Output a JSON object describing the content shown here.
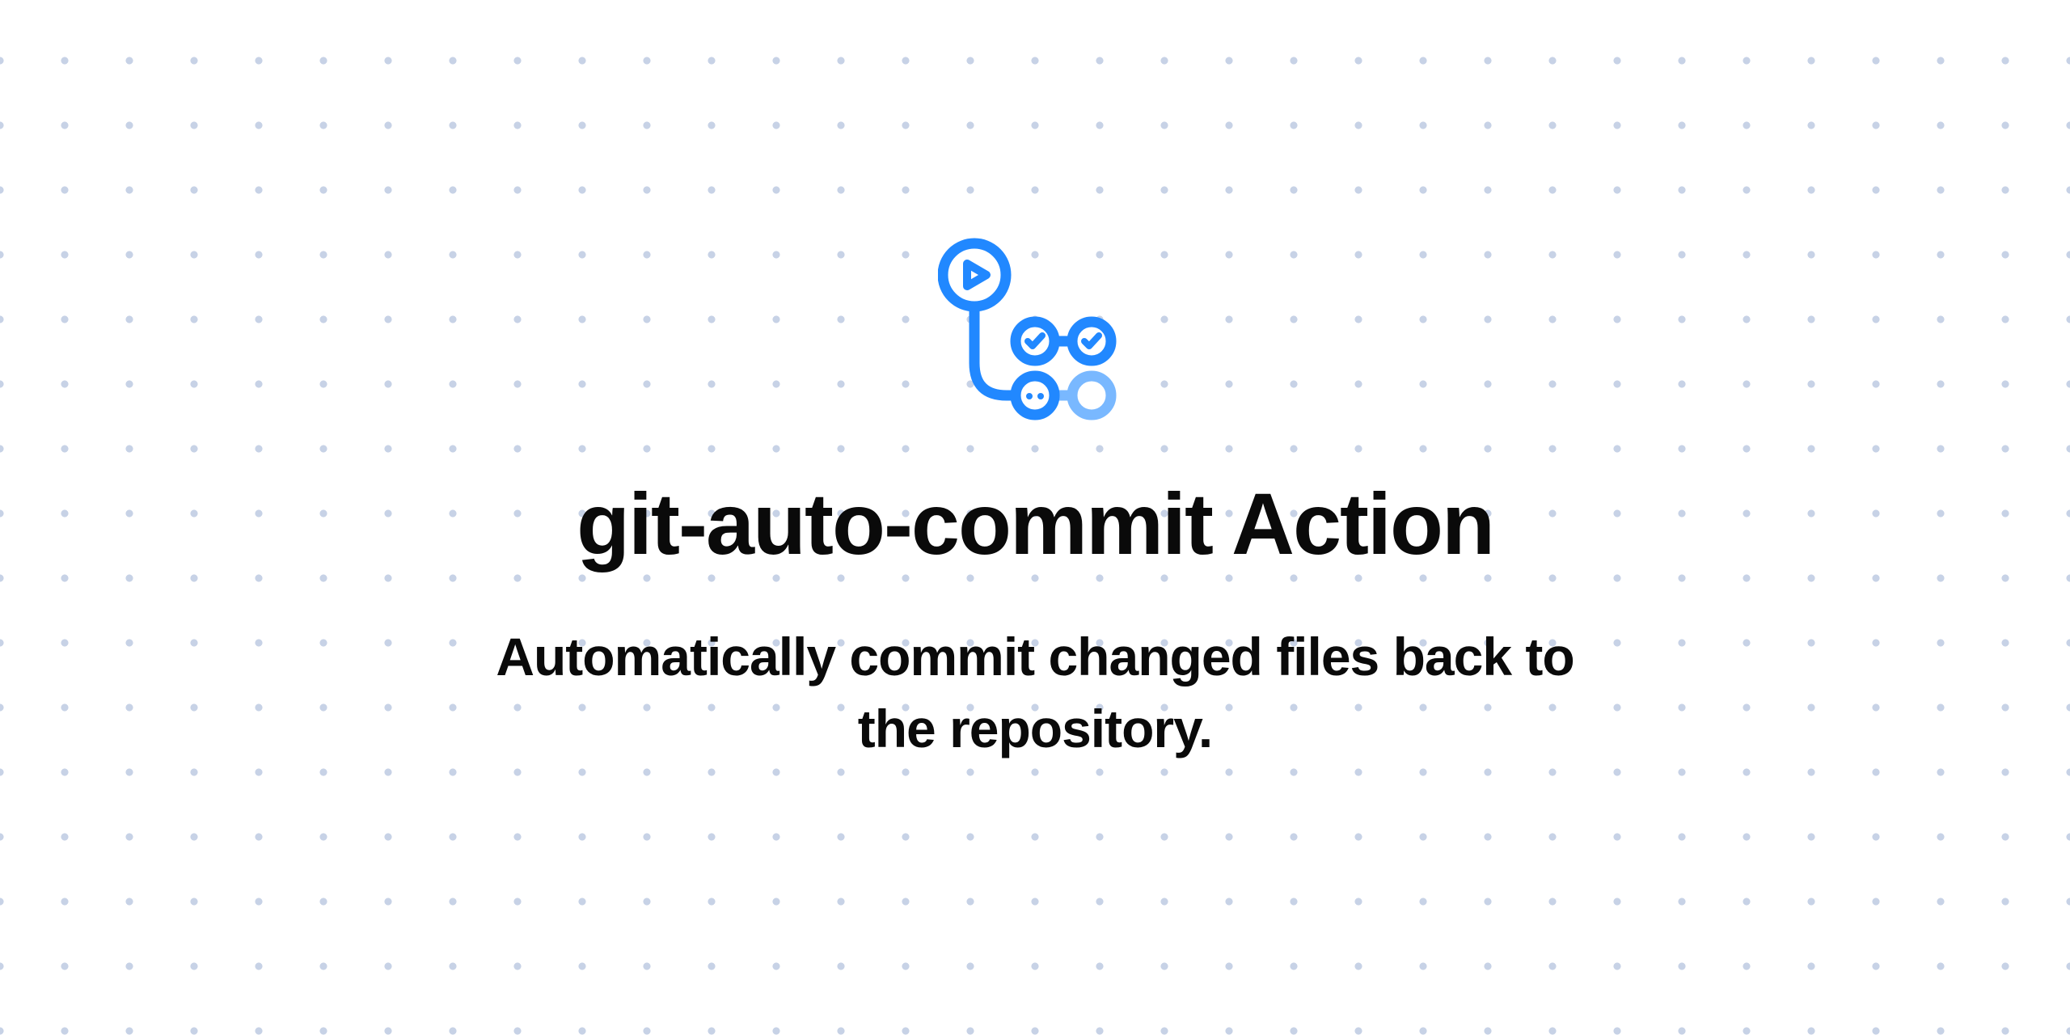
{
  "title": "git-auto-commit Action",
  "subtitle": "Automatically commit changed files back to the repository.",
  "icons": {
    "workflow": "github-actions-workflow-icon"
  },
  "colors": {
    "primary_blue": "#2188ff",
    "light_blue": "#79b8ff",
    "text": "#0a0a0a",
    "dot": "#c7d2e6"
  }
}
